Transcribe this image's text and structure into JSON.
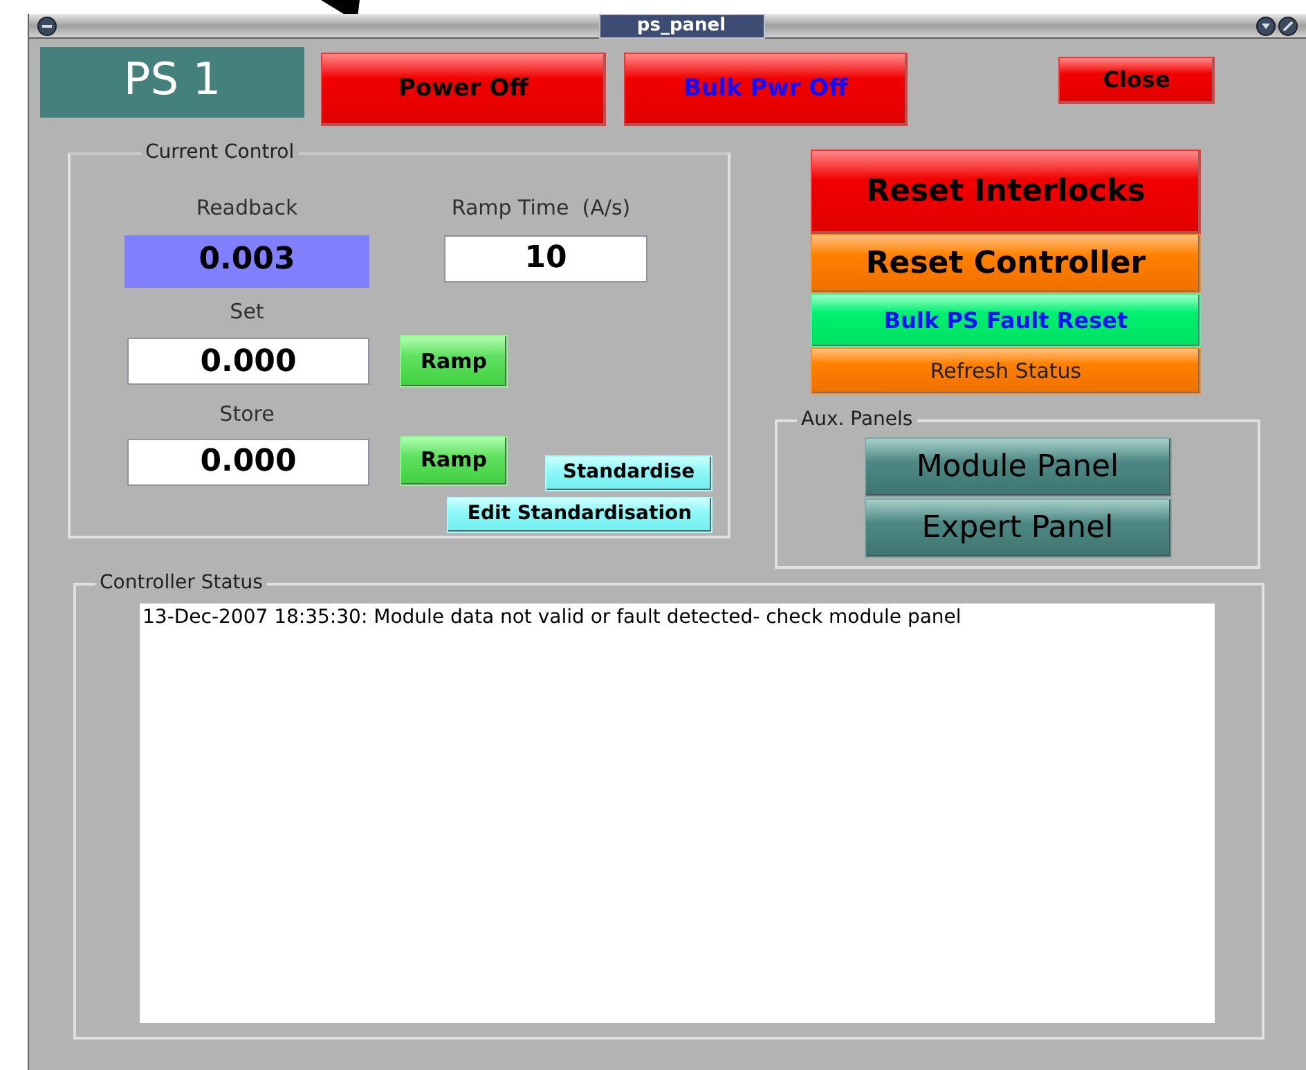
{
  "window": {
    "title": "ps_panel"
  },
  "header": {
    "name": "PS 1",
    "buttons": [
      {
        "label": "Power Off",
        "kind": "red"
      },
      {
        "label": "Bulk Pwr Off",
        "kind": "redblue"
      },
      {
        "label": "Close",
        "kind": "red"
      }
    ]
  },
  "current_control": {
    "title": "Current Control",
    "readback": {
      "label": "Readback",
      "value": "0.003"
    },
    "ramp_time": {
      "label": "Ramp Time  (A/s)",
      "value": "10"
    },
    "set": {
      "label": "Set",
      "value": "0.000",
      "button": "Ramp"
    },
    "store": {
      "label": "Store",
      "value": "0.000",
      "button": "Ramp"
    },
    "standardise_buttons": [
      "Standardise",
      "Edit Standardisation"
    ]
  },
  "actions": [
    {
      "label": "Reset Interlocks",
      "kind": "red"
    },
    {
      "label": "Reset Controller",
      "kind": "orange"
    },
    {
      "label": "Bulk PS Fault Reset",
      "kind": "green"
    },
    {
      "label": "Refresh Status",
      "kind": "orangesmall"
    }
  ],
  "aux_panels": {
    "title": "Aux. Panels",
    "buttons": [
      "Module Panel",
      "Expert Panel"
    ]
  },
  "controller_status": {
    "title": "Controller Status",
    "messages": [
      "13-Dec-2007 18:35:30: Module data not valid or fault detected- check module panel"
    ]
  }
}
